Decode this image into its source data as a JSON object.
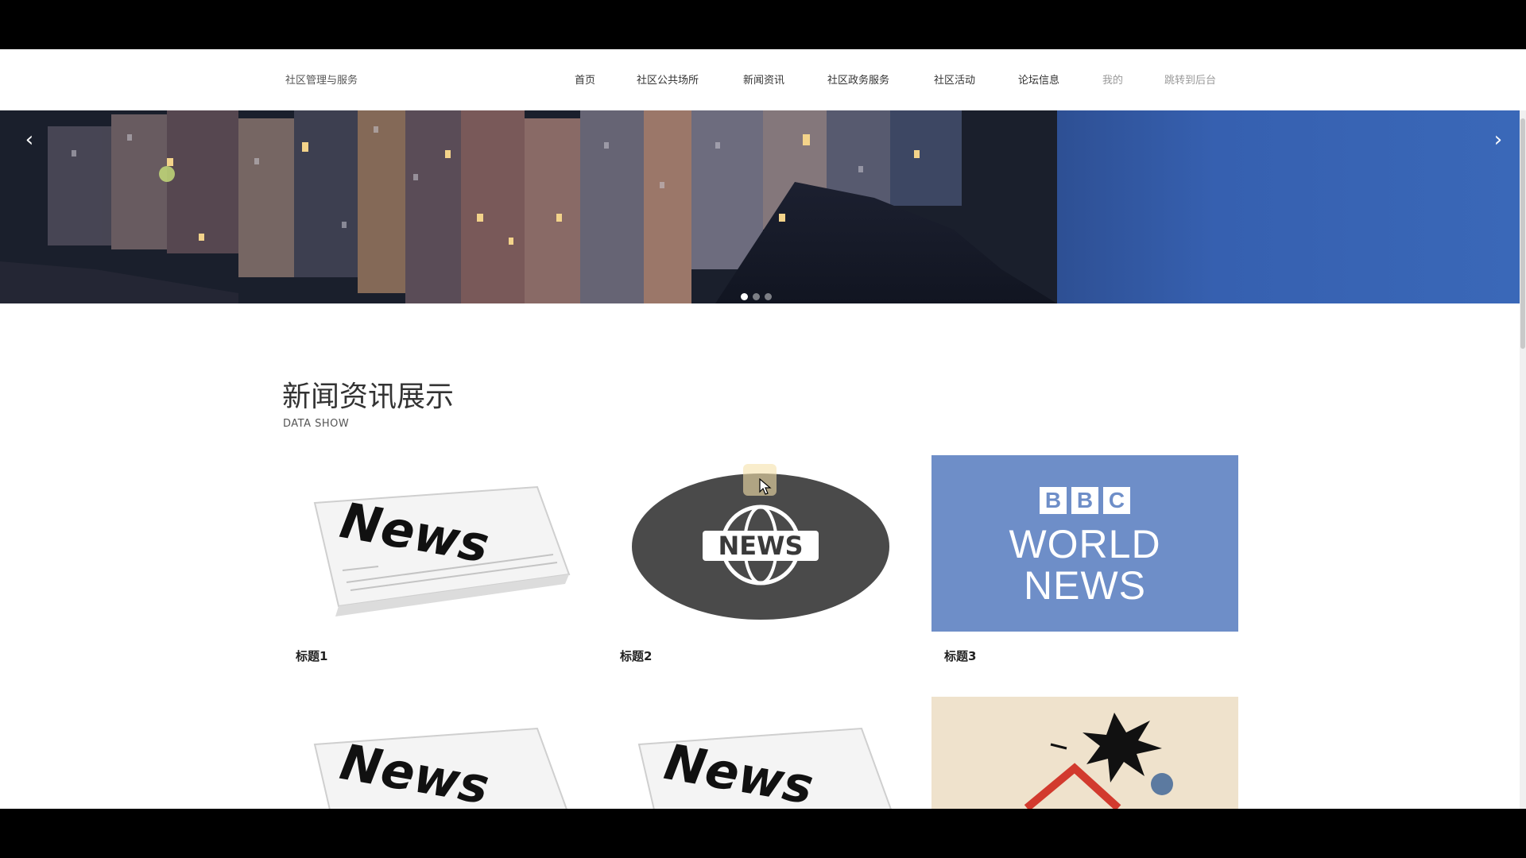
{
  "header": {
    "brand": "社区管理与服务",
    "nav": [
      {
        "label": "首页"
      },
      {
        "label": "社区公共场所"
      },
      {
        "label": "新闻资讯"
      },
      {
        "label": "社区政务服务"
      },
      {
        "label": "社区活动"
      },
      {
        "label": "论坛信息"
      },
      {
        "label": "我的"
      },
      {
        "label": "跳转到后台"
      }
    ]
  },
  "banner": {
    "prev_icon": "chevron-left-icon",
    "next_icon": "chevron-right-icon",
    "prev_glyph": "‹",
    "next_glyph": "›",
    "slide_count": 3,
    "active_slide": 1
  },
  "section": {
    "title": "新闻资讯展示",
    "subtitle": "DATA SHOW"
  },
  "cards": [
    {
      "title": "标题1",
      "image": "newspaper-news"
    },
    {
      "title": "标题2",
      "image": "globe-news"
    },
    {
      "title": "标题3",
      "image": "bbc-world-news",
      "image_text": [
        "B",
        "B",
        "C",
        "WORLD",
        "NEWS"
      ]
    },
    {
      "title": "",
      "image": "newspaper-news"
    },
    {
      "title": "",
      "image": "newspaper-news"
    },
    {
      "title": "",
      "image": "cartoon-explosion"
    }
  ],
  "colors": {
    "bbc_blue": "#6e8ec8",
    "banner_sky": "#3660b0",
    "text": "#333333"
  }
}
